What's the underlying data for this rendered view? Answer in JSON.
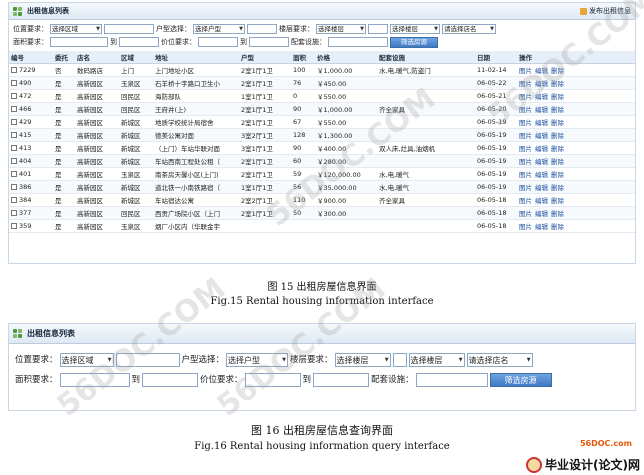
{
  "fig15": {
    "title": "出租信息列表",
    "publish_label": "发布出租信息",
    "filter": {
      "row1": {
        "loc_label": "位置要求：",
        "area_select": "选择区域",
        "type_label": "户型选择：",
        "type_select": "选择户型",
        "floor_label": "楼层要求：",
        "floor_select1": "选择楼层",
        "floor_select2": "选择楼层",
        "building_select": "请选择店名"
      },
      "row2": {
        "size_label": "面积要求：",
        "to1": "到",
        "price_label": "价位要求：",
        "to2": "到",
        "facility_label": "配套设施：",
        "search_btn": "筛选房源"
      }
    },
    "headers": [
      "编号",
      "委托",
      "店名",
      "区域",
      "地址",
      "户型",
      "面积",
      "价格",
      "配套设施",
      "日期",
      "操作"
    ],
    "rows": [
      [
        "7229",
        "否",
        "数码路店",
        "上门",
        "上门地址小区",
        "2室1厅1卫",
        "100",
        "￥1,000.00",
        "水,电,暖气,防盗门",
        "11-02-14"
      ],
      [
        "490",
        "是",
        "高新园区",
        "玉泉区",
        "石羊桥十字路口卫生小",
        "2室1厅1卫",
        "76",
        "￥450.00",
        "",
        "06-05-22"
      ],
      [
        "472",
        "是",
        "高新园区",
        "回民区",
        "海防部队",
        "1室1厅1卫",
        "0",
        "￥550.00",
        "",
        "06-05-21"
      ],
      [
        "466",
        "是",
        "高新园区",
        "回民区",
        "王府井(上)",
        "2室1厅1卫",
        "90",
        "￥1,000.00",
        "齐全家具",
        "06-05-20"
      ],
      [
        "429",
        "是",
        "高新园区",
        "新城区",
        "地质学校统计局宿舍",
        "2室1厅1卫",
        "67",
        "￥550.00",
        "",
        "06-05-19"
      ],
      [
        "415",
        "是",
        "高新园区",
        "新城区",
        "德美公寓对面",
        "3室2厅1卫",
        "128",
        "￥1,300.00",
        "",
        "06-05-19"
      ],
      [
        "413",
        "是",
        "高新园区",
        "新城区",
        "（上门）车站华联对面",
        "3室1厅1卫",
        "90",
        "￥400.00",
        "双人床,灶具,油烟机",
        "06-05-19"
      ],
      [
        "404",
        "是",
        "高新园区",
        "新城区",
        "车站西南工程处公租（",
        "2室1厅1卫",
        "60",
        "￥280.00",
        "",
        "06-05-19"
      ],
      [
        "401",
        "是",
        "高新园区",
        "玉泉区",
        "南茶房天馨小区(上门)",
        "2室1厅1卫",
        "59",
        "￥120,000.00",
        "水,电,暖气",
        "06-05-19"
      ],
      [
        "386",
        "是",
        "高新园区",
        "新城区",
        "道北铁一小南铁路宿（",
        "1室1厅1卫",
        "56",
        "￥35,000.00",
        "水,电,暖气",
        "06-05-19"
      ],
      [
        "384",
        "是",
        "高新园区",
        "新城区",
        "车站宿达公寓",
        "2室2厅1卫",
        "110",
        "￥900.00",
        "齐全家具",
        "06-05-18"
      ],
      [
        "377",
        "是",
        "高新园区",
        "回民区",
        "西贡广场院小区（上门",
        "2室1厅1卫",
        "50",
        "￥300.00",
        "",
        "06-05-18"
      ],
      [
        "359",
        "是",
        "高新园区",
        "玉泉区",
        "烟厂小区内（华联金宇",
        "",
        "",
        "",
        "",
        "06-05-18"
      ]
    ],
    "actions": [
      "图片",
      "编辑",
      "删除"
    ],
    "caption_cn": "图 15    出租房屋信息界面",
    "caption_en": "Fig.15 Rental housing information interface"
  },
  "fig16": {
    "title": "出租信息列表",
    "filter": {
      "loc_label": "位置要求：",
      "area_select": "选择区域",
      "type_label": "户型选择：",
      "type_select": "选择户型",
      "floor_label": "楼层要求：",
      "floor_select1": "选择楼层",
      "floor_select2": "选择楼层",
      "building_select": "请选择店名",
      "size_label": "面积要求：",
      "to1": "到",
      "price_label": "价位要求：",
      "to2": "到",
      "facility_label": "配套设施：",
      "search_btn": "筛选房源"
    },
    "caption_cn": "图 16    出租房屋信息查询界面",
    "caption_en": "Fig.16 Rental housing information query interface"
  },
  "watermark": "56DOC.COM",
  "logo": {
    "top": "56DOC.com",
    "main": "毕业设计(论文)网"
  }
}
